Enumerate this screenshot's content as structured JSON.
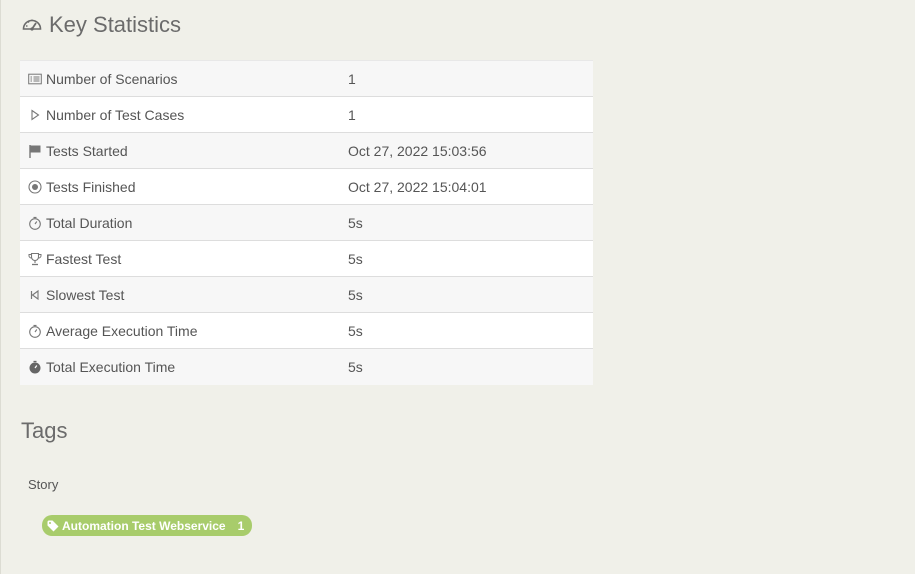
{
  "key_statistics": {
    "title": "Key Statistics",
    "icon": "dashboard-icon",
    "rows": [
      {
        "icon": "list-icon",
        "label": "Number of Scenarios",
        "value": "1"
      },
      {
        "icon": "play-icon",
        "label": "Number of Test Cases",
        "value": "1"
      },
      {
        "icon": "flag-icon",
        "label": "Tests Started",
        "value": "Oct 27, 2022 15:03:56"
      },
      {
        "icon": "stop-circle-icon",
        "label": "Tests Finished",
        "value": "Oct 27, 2022 15:04:01"
      },
      {
        "icon": "stopwatch-icon",
        "label": "Total Duration",
        "value": "5s"
      },
      {
        "icon": "trophy-icon",
        "label": "Fastest Test",
        "value": "5s"
      },
      {
        "icon": "step-backward-icon",
        "label": "Slowest Test",
        "value": "5s"
      },
      {
        "icon": "stopwatch-icon",
        "label": "Average Execution Time",
        "value": "5s"
      },
      {
        "icon": "stopwatch-solid-icon",
        "label": "Total Execution Time",
        "value": "5s"
      }
    ]
  },
  "tags": {
    "title": "Tags",
    "groups": [
      {
        "label": "Story",
        "items": [
          {
            "icon": "tag-icon",
            "name": "Automation Test Webservice",
            "count": "1"
          }
        ]
      }
    ]
  },
  "colors": {
    "background": "#f0f0e9",
    "tag_pill": "#a8cc6b",
    "text": "#555555"
  }
}
